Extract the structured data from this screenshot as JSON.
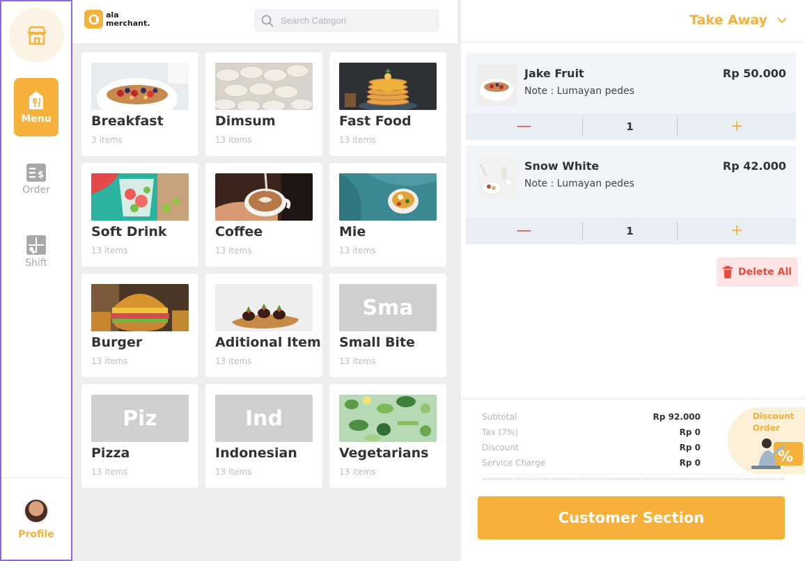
{
  "sidebar": {
    "store_icon": "store-icon",
    "items": [
      {
        "label": "Menu",
        "icon": "menu-fork-icon",
        "active": true
      },
      {
        "label": "Order",
        "icon": "order-receipt-icon",
        "active": false
      },
      {
        "label": "Shift",
        "icon": "shift-icon",
        "active": false
      }
    ],
    "profile": {
      "label": "Profile"
    }
  },
  "header": {
    "logo_line1": "ala",
    "logo_line2": "merchant.",
    "search_placeholder": "Search Categori"
  },
  "categories": [
    {
      "name": "Breakfast",
      "count": "3 items",
      "image": "breakfast-photo"
    },
    {
      "name": "Dimsum",
      "count": "13 items",
      "image": "dimsum-photo"
    },
    {
      "name": "Fast Food",
      "count": "13 items",
      "image": "pancake-photo"
    },
    {
      "name": "Soft Drink",
      "count": "13 items",
      "image": "soft-drink-photo"
    },
    {
      "name": "Coffee",
      "count": "13 items",
      "image": "coffee-photo"
    },
    {
      "name": "Mie",
      "count": "13 items",
      "image": "noodle-photo"
    },
    {
      "name": "Burger",
      "count": "13 items",
      "image": "burger-photo"
    },
    {
      "name": "Aditional Item",
      "count": "13 items",
      "image": "additional-item-photo"
    },
    {
      "name": "Small Bite",
      "count": "13 items",
      "placeholder": "Sma"
    },
    {
      "name": "Pizza",
      "count": "13 items",
      "placeholder": "Piz"
    },
    {
      "name": "Indonesian",
      "count": "13 items",
      "placeholder": "Ind"
    },
    {
      "name": "Vegetarians",
      "count": "13 items",
      "image": "vegetarian-photo"
    }
  ],
  "order": {
    "type": "Take Away",
    "items": [
      {
        "title": "Jake Fruit",
        "note": "Note : Lumayan pedes",
        "price": "Rp 50.000",
        "qty": "1"
      },
      {
        "title": "Snow White",
        "note": "Note : Lumayan pedes",
        "price": "Rp 42.000",
        "qty": "1"
      }
    ],
    "delete_all": "Delete All",
    "summary": {
      "subtotal_label": "Subtotal",
      "subtotal": "Rp 92.000",
      "tax_label": "Tax (7%)",
      "tax": "Rp 0",
      "discount_label": "Discount",
      "discount": "Rp 0",
      "service_label": "Service Charge",
      "service": "Rp 0"
    },
    "discount_badge_line1": "Discount",
    "discount_badge_line2": "Order",
    "customer_button": "Customer Section"
  },
  "colors": {
    "accent": "#f5b139",
    "danger": "#e74c3c",
    "panel_bg": "#ededed",
    "sidebar_border": "#8d63e8"
  }
}
